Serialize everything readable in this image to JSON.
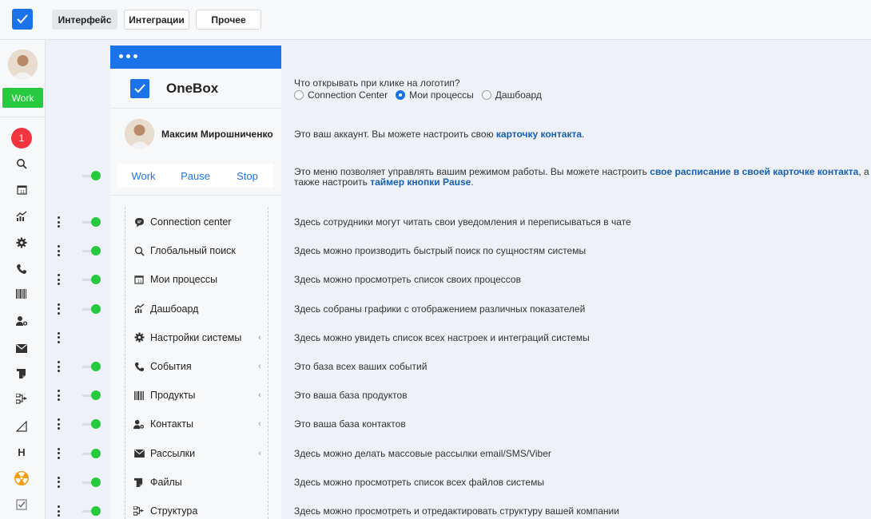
{
  "topbar": {
    "tabs": [
      {
        "label": "Интерфейс",
        "active": true
      },
      {
        "label": "Интеграции",
        "active": false
      },
      {
        "label": "Прочее",
        "active": false
      }
    ]
  },
  "leftnav": {
    "work_label": "Work",
    "badge_count": "1",
    "icons": [
      "search-icon",
      "calendar-icon",
      "chart-icon",
      "gear-icon",
      "phone-icon",
      "barcode-icon",
      "add-contact-icon",
      "mail-icon",
      "files-icon",
      "structure-icon",
      "triangle-icon",
      "h-letter-icon",
      "radiation-icon",
      "checkbox-icon"
    ],
    "h_letter": "H"
  },
  "panel": {
    "brand": "OneBox",
    "user_name": "Максим Мирошниченко",
    "mode_buttons": [
      "Work",
      "Pause",
      "Stop"
    ],
    "menu": [
      {
        "label": "Connection center",
        "icon": "chat-icon",
        "chevron": false
      },
      {
        "label": "Глобальный поиск",
        "icon": "search-icon",
        "chevron": false
      },
      {
        "label": "Мои процессы",
        "icon": "calendar-icon",
        "chevron": false
      },
      {
        "label": "Дашбоард",
        "icon": "chart-icon",
        "chevron": false
      },
      {
        "label": "Настройки системы",
        "icon": "gear-icon",
        "chevron": true
      },
      {
        "label": "События",
        "icon": "phone-icon",
        "chevron": true
      },
      {
        "label": "Продукты",
        "icon": "barcode-icon",
        "chevron": true
      },
      {
        "label": "Контакты",
        "icon": "add-contact-icon",
        "chevron": true
      },
      {
        "label": "Рассылки",
        "icon": "mail-icon",
        "chevron": true
      },
      {
        "label": "Файлы",
        "icon": "files-icon",
        "chevron": false
      },
      {
        "label": "Структура",
        "icon": "structure-icon",
        "chevron": false
      }
    ]
  },
  "logo_setting": {
    "question": "Что открывать при клике на логотип?",
    "options": [
      "Connection Center",
      "Мои процессы",
      "Дашбоард"
    ],
    "selected": "Мои процессы"
  },
  "descriptions": {
    "account_text": "Это ваш аккаунт. Вы можете настроить свою ",
    "account_link": "карточку контакта",
    "account_tail": ".",
    "mode_text": "Это меню позволяет управлять вашим режимом работы. Вы можете настроить ",
    "mode_link": "свое расписание в своей карточке контакта",
    "mode_tail": ", а",
    "mode_text2": "также настроить ",
    "mode_link2": "таймер кнопки Pause",
    "mode_tail2": ".",
    "items": [
      "Здесь сотрудники могут читать свои уведомления и переписываться в чате",
      "Здесь можно производить быстрый поиск по сущностям системы",
      "Здесь можно просмотреть список своих процессов",
      "Здесь собраны графики с отображением различных показателей",
      "Здесь можно увидеть список всех настроек и интеграций системы",
      "Это база всех ваших событий",
      "Это ваша база продуктов",
      "Это ваша база контактов",
      "Здесь можно делать массовые рассылки email/SMS/Viber",
      "Здесь можно просмотреть список всех файлов системы",
      "Здесь можно просмотреть и отредактировать структуру вашей компании"
    ]
  },
  "toggles": {
    "mode_enabled": true,
    "items_enabled": [
      true,
      true,
      true,
      true,
      false,
      true,
      true,
      true,
      true,
      true,
      true
    ]
  },
  "colors": {
    "accent": "#1a73e8",
    "green": "#27c93f",
    "badge_red": "#f0353f",
    "link": "#1a5fb4"
  }
}
